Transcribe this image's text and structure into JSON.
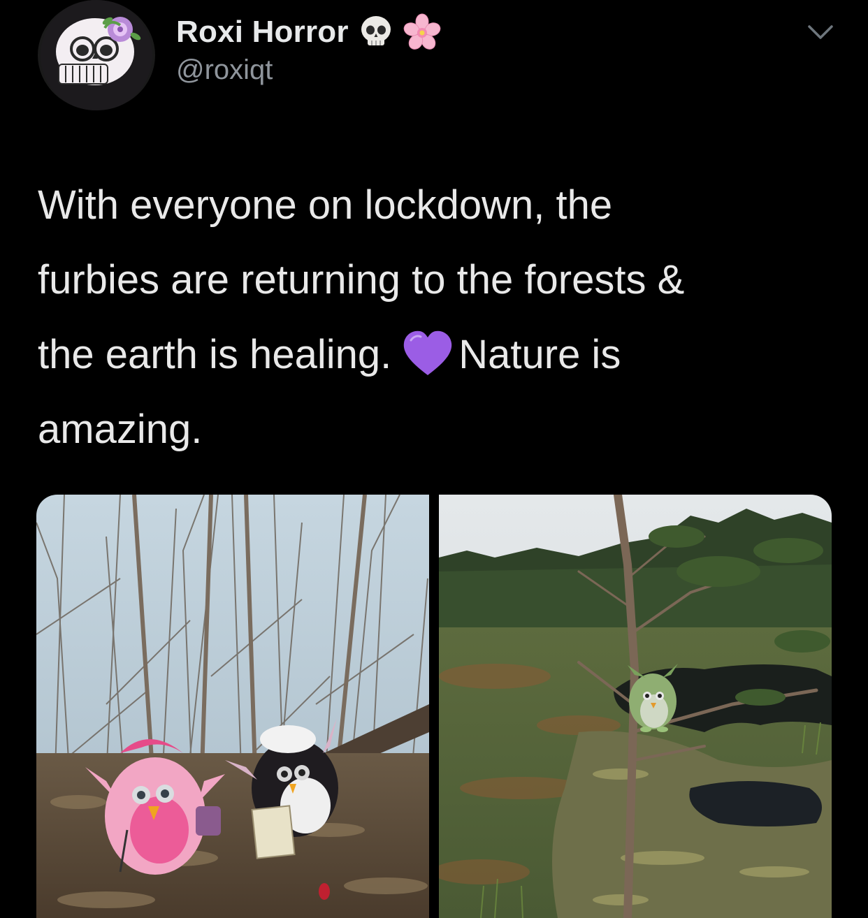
{
  "author": {
    "display_name": "Roxi Horror",
    "handle": "@roxiqt",
    "name_emojis": [
      "skull-emoji",
      "cherry-blossom-emoji"
    ]
  },
  "tweet": {
    "line1": "With everyone on lockdown, the",
    "line2": "furbies are returning to the forests &",
    "line3_before_emoji": "the earth is healing.",
    "line3_after_emoji": "Nature is",
    "line4": "amazing.",
    "inline_emoji": "purple-heart-emoji"
  },
  "colors": {
    "background": "#000000",
    "text": "#e9e9e9",
    "secondary_text": "#8f959c",
    "heart": "#9b5de5"
  },
  "media": {
    "photos": [
      {
        "subject": "pink and black furby toys in a leafless forest"
      },
      {
        "subject": "green furby toy in a pine tree above a bog pond"
      }
    ]
  }
}
